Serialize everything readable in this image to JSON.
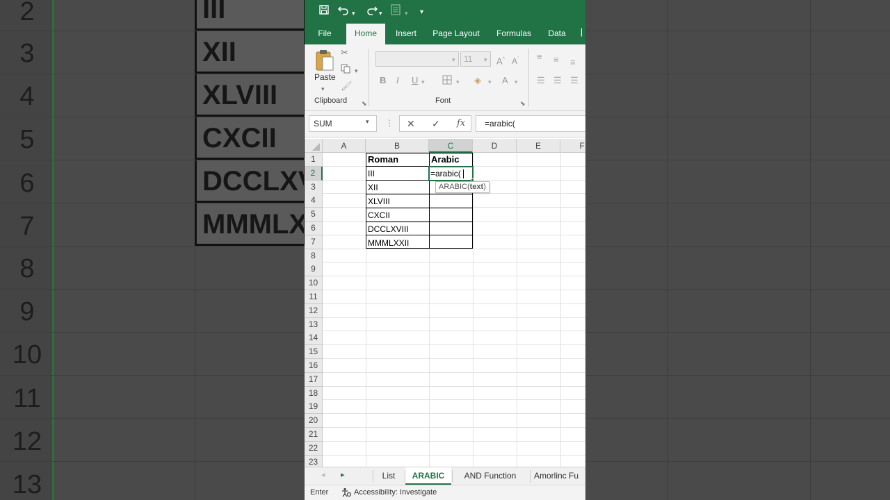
{
  "background": {
    "row_numbers": [
      "2",
      "3",
      "4",
      "5",
      "6",
      "7",
      "8",
      "9",
      "10",
      "11",
      "12",
      "13"
    ],
    "cells": [
      "III",
      "XII",
      "XLVIII",
      "CXCII",
      "DCCLXV",
      "MMMLX"
    ]
  },
  "quick_access": {
    "save_icon": "save-icon",
    "undo_icon": "undo-icon",
    "redo_icon": "redo-icon"
  },
  "ribbon_tabs": [
    {
      "label": "File"
    },
    {
      "label": "Home"
    },
    {
      "label": "Insert"
    },
    {
      "label": "Page Layout"
    },
    {
      "label": "Formulas"
    },
    {
      "label": "Data"
    }
  ],
  "ribbon": {
    "paste_label": "Paste",
    "clipboard_label": "Clipboard",
    "font_label": "Font",
    "font_size": "11",
    "bold": "B",
    "italic": "I",
    "underline": "U"
  },
  "formula_bar": {
    "name_box": "SUM",
    "fx": "fx",
    "formula": "=arabic("
  },
  "columns": [
    "A",
    "B",
    "C",
    "D",
    "E",
    "F"
  ],
  "rows": [
    "1",
    "2",
    "3",
    "4",
    "5",
    "6",
    "7",
    "8",
    "9",
    "10",
    "11",
    "12",
    "13",
    "14",
    "15",
    "16",
    "17",
    "18",
    "19",
    "20",
    "21",
    "22",
    "23"
  ],
  "table": {
    "header_b": "Roman",
    "header_c": "Arabic",
    "roman": [
      "III",
      "XII",
      "XLVIII",
      "CXCII",
      "DCCLXVIII",
      "MMMLXXII"
    ],
    "active_edit": "=arabic(",
    "tooltip_fn": "ARABIC(",
    "tooltip_arg": "text",
    "tooltip_close": ")"
  },
  "sheet_tabs": [
    {
      "label": "List"
    },
    {
      "label": "ARABIC"
    },
    {
      "label": "AND Function"
    },
    {
      "label": "Amorlinc Fu"
    }
  ],
  "status": {
    "mode": "Enter",
    "accessibility": "Accessibility: Investigate"
  },
  "colors": {
    "excel_green": "#217346"
  }
}
